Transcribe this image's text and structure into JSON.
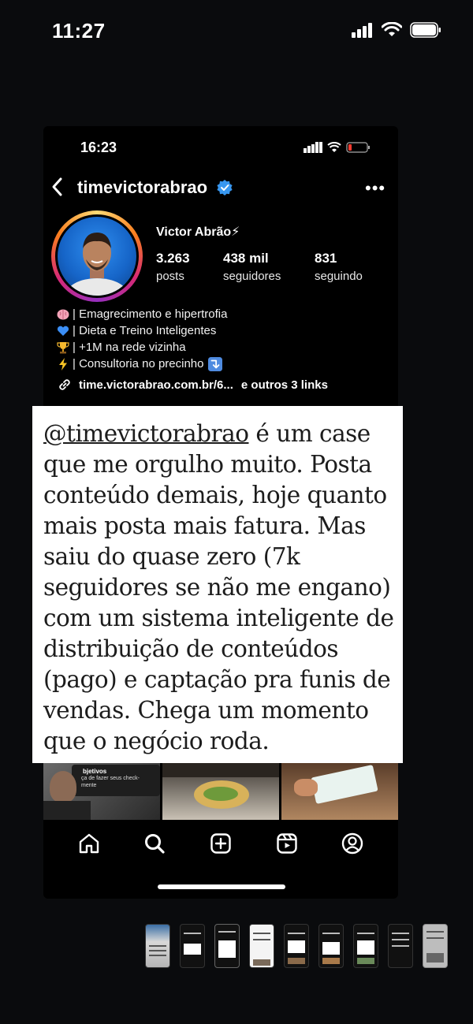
{
  "status_bar": {
    "time": "11:27"
  },
  "inner_status": {
    "time": "16:23"
  },
  "profile": {
    "username": "timevictorabrao",
    "name": "Victor Abrão⚡",
    "stats": [
      {
        "value": "3.263",
        "label": "posts"
      },
      {
        "value": "438 mil",
        "label": "seguidores"
      },
      {
        "value": "831",
        "label": "seguindo"
      }
    ],
    "bio": [
      {
        "icon": "brain-emoji",
        "text": "| Emagrecimento e hipertrofia"
      },
      {
        "icon": "blue-heart-emoji",
        "text": "| Dieta e Treino Inteligentes"
      },
      {
        "icon": "trophy-emoji",
        "text": "| +1M na rede vizinha"
      },
      {
        "icon": "lightning-emoji",
        "text": "| Consultoria no precinho"
      }
    ],
    "link": "time.victorabrao.com.br/6...",
    "more_links": "e outros 3 links"
  },
  "caption": {
    "mention": "@timevictorabrao",
    "line1_rest": " é um case",
    "lines": [
      "que me orgulho muito. Posta",
      "conteúdo demais, hoje quanto",
      "mais posta mais fatura. Mas",
      "saiu do quase zero (7k",
      "seguidores se não me engano)",
      "com um sistema inteligente de",
      "distribuição de conteúdos",
      "(pago) e captação pra funis de",
      "vendas. Chega um momento",
      "que o negócio roda."
    ]
  },
  "grid": {
    "cell1_title": "bjetivos",
    "cell1_sub": "ça de fazer seus check-",
    "cell1_sub2": "mente"
  },
  "tabbar": [
    "home-icon",
    "search-icon",
    "create-icon",
    "reels-icon",
    "profile-icon"
  ],
  "colors": {
    "verified": "#3897f0",
    "battery_low": "#ff3b30"
  }
}
